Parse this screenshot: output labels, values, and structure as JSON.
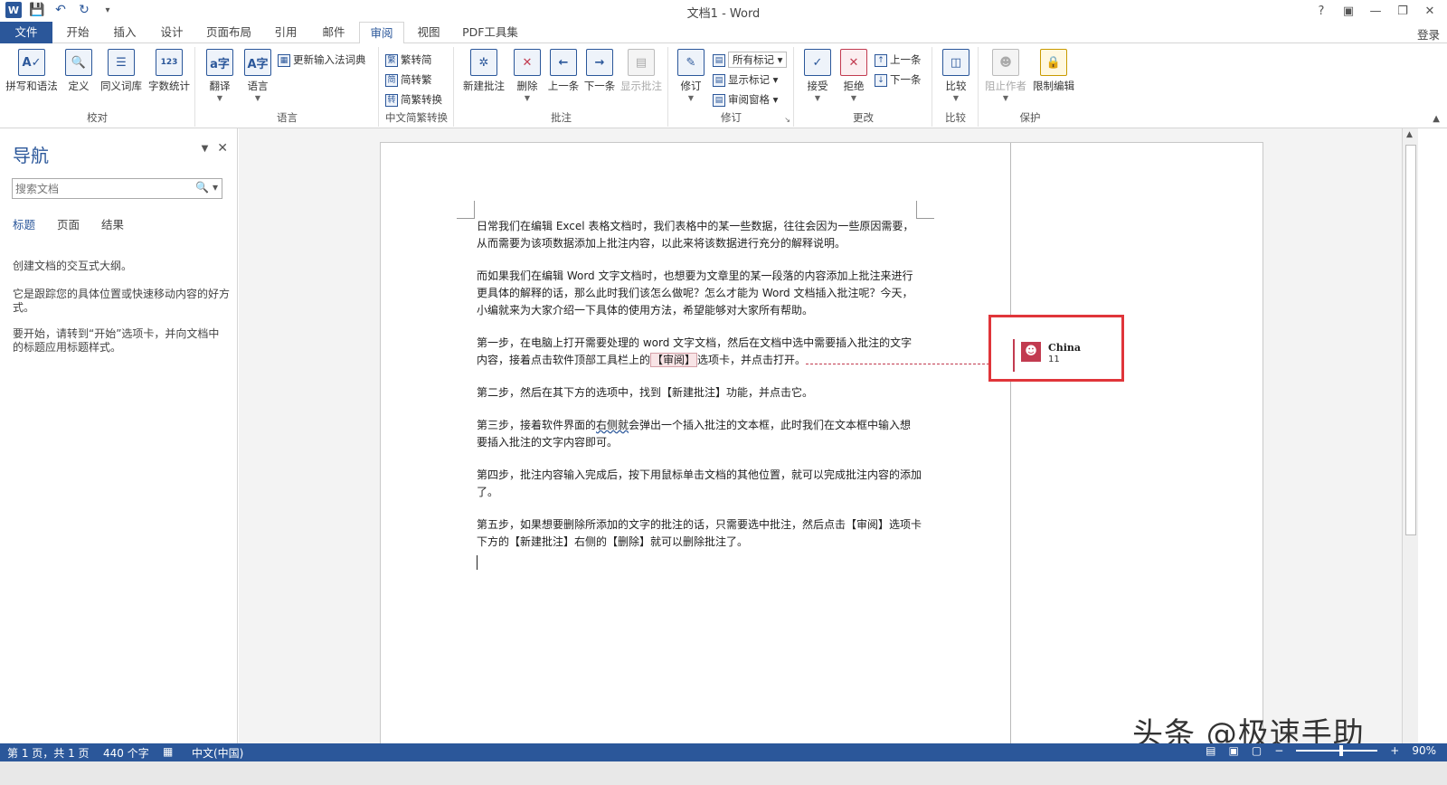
{
  "app": {
    "title": "文档1 - Word",
    "help": "?",
    "login": "登录"
  },
  "tabs": [
    "文件",
    "开始",
    "插入",
    "设计",
    "页面布局",
    "引用",
    "邮件",
    "审阅",
    "视图",
    "PDF工具集"
  ],
  "ribbon": {
    "proofing": {
      "label": "校对",
      "spell": "拼写和语法",
      "define": "定义",
      "thesaurus": "同义词库",
      "wordcount": "字数统计"
    },
    "language": {
      "label": "语言",
      "translate": "翻译",
      "language": "语言",
      "update_ime": "更新输入法词典"
    },
    "chinese": {
      "label": "中文简繁转换",
      "to_simplified": "繁转简",
      "to_traditional": "简转繁",
      "convert": "简繁转换"
    },
    "comments": {
      "label": "批注",
      "new": "新建批注",
      "delete": "删除",
      "prev": "上一条",
      "next": "下一条",
      "show": "显示批注"
    },
    "tracking": {
      "label": "修订",
      "track": "修订",
      "all_markup": "所有标记",
      "show_markup": "显示标记",
      "review_pane": "审阅窗格"
    },
    "changes": {
      "label": "更改",
      "accept": "接受",
      "reject": "拒绝",
      "prev": "上一条",
      "next": "下一条"
    },
    "compare": {
      "label": "比较",
      "compare": "比较"
    },
    "protect": {
      "label": "保护",
      "block": "阻止作者",
      "restrict": "限制编辑"
    }
  },
  "nav": {
    "title": "导航",
    "search_placeholder": "搜索文档",
    "tabs": [
      "标题",
      "页面",
      "结果"
    ],
    "hint1": "创建文档的交互式大纲。",
    "hint2": "它是跟踪您的具体位置或快速移动内容的好方式。",
    "hint3": "要开始，请转到“开始”选项卡，并向文档中的标题应用标题样式。"
  },
  "document": {
    "p1": "日常我们在编辑 Excel 表格文档时，我们表格中的某一些数据，往往会因为一些原因需要，从而需要为该项数据添加上批注内容，以此来将该数据进行充分的解释说明。",
    "p2": "而如果我们在编辑 Word 文字文档时，也想要为文章里的某一段落的内容添加上批注来进行更具体的解释的话，那么此时我们该怎么做呢？怎么才能为 Word 文档插入批注呢？今天，小编就来为大家介绍一下具体的使用方法，希望能够对大家所有帮助。",
    "p3a": "第一步，在电脑上打开需要处理的 word 文字文档，然后在文档中选中需要插入批注的文字内容，接着点击软件顶部工具栏上的",
    "p3hl": "【审阅】",
    "p3b": "选项卡，并点击打开。",
    "p4": "第二步，然后在其下方的选项中，找到【新建批注】功能，并点击它。",
    "p5a": "第三步，接着软件界面的",
    "p5sq": "右侧就",
    "p5b": "会弹出一个插入批注的文本框，此时我们在文本框中输入想要插入批注的文字内容即可。",
    "p6": "第四步，批注内容输入完成后，按下用鼠标单击文档的其他位置，就可以完成批注内容的添加了。",
    "p7": "第五步，如果想要删除所添加的文字的批注的话，只需要选中批注，然后点击【审阅】选项卡下方的【新建批注】右侧的【删除】就可以删除批注了。"
  },
  "comment": {
    "author": "China",
    "text": "11"
  },
  "status": {
    "page": "第 1 页，共 1 页",
    "words": "440 个字",
    "lang": "中文(中国)",
    "zoom": "90%"
  },
  "watermark": "头条 @极速手助",
  "colors": {
    "accent": "#2b579a",
    "comment": "#c23b50",
    "highlight_box": "#e0353a"
  }
}
